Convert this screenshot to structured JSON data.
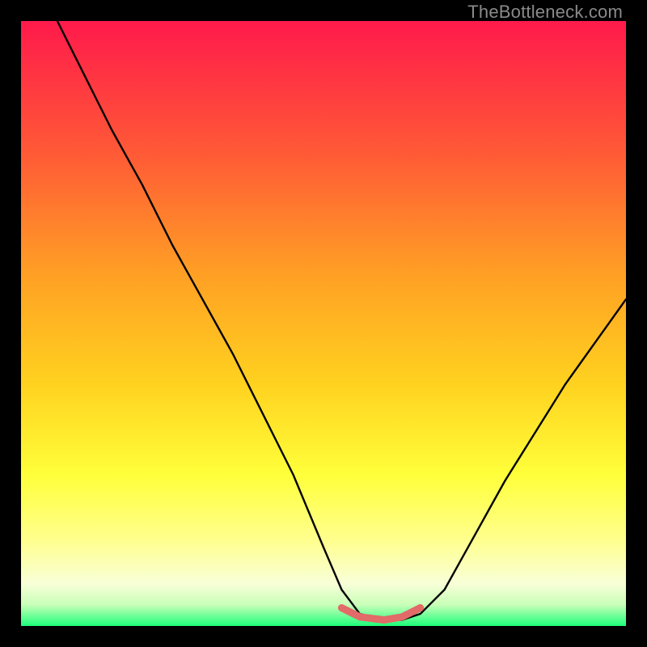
{
  "watermark": "TheBottleneck.com",
  "colors": {
    "frame": "#000000",
    "gradient_top": "#ff1a4b",
    "gradient_mid1": "#ff7a2a",
    "gradient_mid2": "#ffd21f",
    "gradient_mid3": "#ffff55",
    "gradient_mid4": "#f6ffb0",
    "gradient_bottom": "#1cff7a",
    "curve": "#000000",
    "flat_segment": "#e26a68"
  },
  "chart_data": {
    "type": "line",
    "title": "",
    "xlabel": "",
    "ylabel": "",
    "xlim": [
      0,
      100
    ],
    "ylim": [
      0,
      100
    ],
    "series": [
      {
        "name": "bottleneck-curve",
        "x": [
          6,
          10,
          15,
          20,
          25,
          30,
          35,
          40,
          45,
          50,
          53,
          56,
          60,
          63,
          66,
          70,
          75,
          80,
          85,
          90,
          95,
          100
        ],
        "y": [
          100,
          92,
          82,
          73,
          63,
          54,
          45,
          35,
          25,
          13,
          6,
          2,
          1,
          1,
          2,
          6,
          15,
          24,
          32,
          40,
          47,
          54
        ]
      }
    ],
    "annotations": [
      {
        "name": "flat-bottom-segment",
        "x": [
          53,
          56,
          60,
          63,
          66
        ],
        "y": [
          3,
          1.5,
          1,
          1.5,
          3
        ],
        "color": "#e26a68"
      }
    ]
  }
}
